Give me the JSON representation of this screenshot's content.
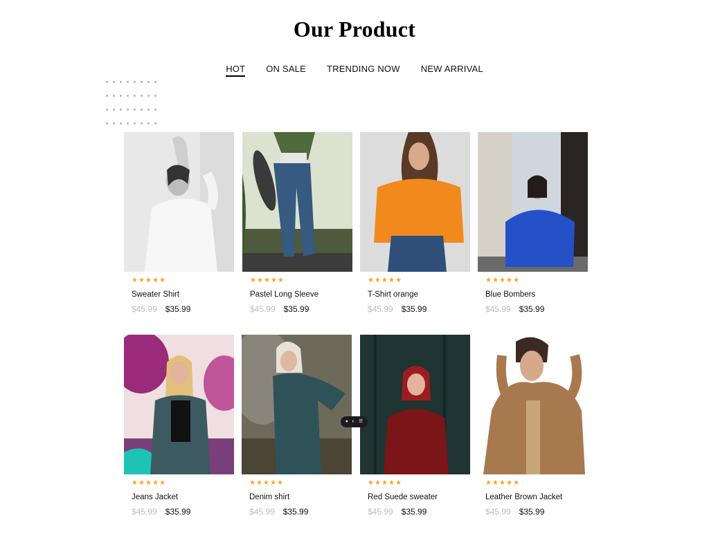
{
  "header": {
    "title": "Our Product"
  },
  "tabs": [
    {
      "label": "HOT",
      "active": true
    },
    {
      "label": "ON SALE",
      "active": false
    },
    {
      "label": "TRENDING NOW",
      "active": false
    },
    {
      "label": "NEW ARRIVAL",
      "active": false
    }
  ],
  "rating_glyph": "★",
  "products": [
    {
      "name": "Sweater Shirt",
      "old_price": "$45.99",
      "price": "$35.99",
      "rating": 5
    },
    {
      "name": "Pastel Long Sleeve",
      "old_price": "$45.99",
      "price": "$35.99",
      "rating": 5
    },
    {
      "name": "T-Shirt orange",
      "old_price": "$45.99",
      "price": "$35.99",
      "rating": 5
    },
    {
      "name": "Blue Bombers",
      "old_price": "$45.99",
      "price": "$35.99",
      "rating": 5
    },
    {
      "name": "Jeans Jacket",
      "old_price": "$45.99",
      "price": "$35.99",
      "rating": 5
    },
    {
      "name": "Denim shirt",
      "old_price": "$45.99",
      "price": "$35.99",
      "rating": 5
    },
    {
      "name": "Red Suede sweater",
      "old_price": "$45.99",
      "price": "$35.99",
      "rating": 5
    },
    {
      "name": "Leather Brown Jacket",
      "old_price": "$45.99",
      "price": "$35.99",
      "rating": 5
    }
  ],
  "colors": {
    "star": "#f6a623",
    "old_price": "#bdbdbd",
    "dots": "#b3b3b3"
  }
}
